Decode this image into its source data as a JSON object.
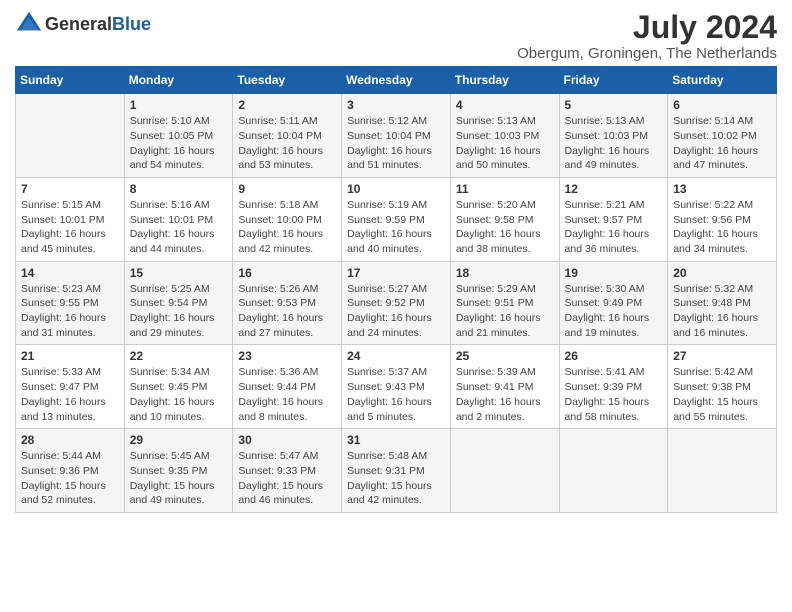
{
  "header": {
    "logo_general": "General",
    "logo_blue": "Blue",
    "month_year": "July 2024",
    "location": "Obergum, Groningen, The Netherlands"
  },
  "days_of_week": [
    "Sunday",
    "Monday",
    "Tuesday",
    "Wednesday",
    "Thursday",
    "Friday",
    "Saturday"
  ],
  "weeks": [
    [
      {
        "day": "",
        "info": ""
      },
      {
        "day": "1",
        "info": "Sunrise: 5:10 AM\nSunset: 10:05 PM\nDaylight: 16 hours\nand 54 minutes."
      },
      {
        "day": "2",
        "info": "Sunrise: 5:11 AM\nSunset: 10:04 PM\nDaylight: 16 hours\nand 53 minutes."
      },
      {
        "day": "3",
        "info": "Sunrise: 5:12 AM\nSunset: 10:04 PM\nDaylight: 16 hours\nand 51 minutes."
      },
      {
        "day": "4",
        "info": "Sunrise: 5:13 AM\nSunset: 10:03 PM\nDaylight: 16 hours\nand 50 minutes."
      },
      {
        "day": "5",
        "info": "Sunrise: 5:13 AM\nSunset: 10:03 PM\nDaylight: 16 hours\nand 49 minutes."
      },
      {
        "day": "6",
        "info": "Sunrise: 5:14 AM\nSunset: 10:02 PM\nDaylight: 16 hours\nand 47 minutes."
      }
    ],
    [
      {
        "day": "7",
        "info": "Sunrise: 5:15 AM\nSunset: 10:01 PM\nDaylight: 16 hours\nand 45 minutes."
      },
      {
        "day": "8",
        "info": "Sunrise: 5:16 AM\nSunset: 10:01 PM\nDaylight: 16 hours\nand 44 minutes."
      },
      {
        "day": "9",
        "info": "Sunrise: 5:18 AM\nSunset: 10:00 PM\nDaylight: 16 hours\nand 42 minutes."
      },
      {
        "day": "10",
        "info": "Sunrise: 5:19 AM\nSunset: 9:59 PM\nDaylight: 16 hours\nand 40 minutes."
      },
      {
        "day": "11",
        "info": "Sunrise: 5:20 AM\nSunset: 9:58 PM\nDaylight: 16 hours\nand 38 minutes."
      },
      {
        "day": "12",
        "info": "Sunrise: 5:21 AM\nSunset: 9:57 PM\nDaylight: 16 hours\nand 36 minutes."
      },
      {
        "day": "13",
        "info": "Sunrise: 5:22 AM\nSunset: 9:56 PM\nDaylight: 16 hours\nand 34 minutes."
      }
    ],
    [
      {
        "day": "14",
        "info": "Sunrise: 5:23 AM\nSunset: 9:55 PM\nDaylight: 16 hours\nand 31 minutes."
      },
      {
        "day": "15",
        "info": "Sunrise: 5:25 AM\nSunset: 9:54 PM\nDaylight: 16 hours\nand 29 minutes."
      },
      {
        "day": "16",
        "info": "Sunrise: 5:26 AM\nSunset: 9:53 PM\nDaylight: 16 hours\nand 27 minutes."
      },
      {
        "day": "17",
        "info": "Sunrise: 5:27 AM\nSunset: 9:52 PM\nDaylight: 16 hours\nand 24 minutes."
      },
      {
        "day": "18",
        "info": "Sunrise: 5:29 AM\nSunset: 9:51 PM\nDaylight: 16 hours\nand 21 minutes."
      },
      {
        "day": "19",
        "info": "Sunrise: 5:30 AM\nSunset: 9:49 PM\nDaylight: 16 hours\nand 19 minutes."
      },
      {
        "day": "20",
        "info": "Sunrise: 5:32 AM\nSunset: 9:48 PM\nDaylight: 16 hours\nand 16 minutes."
      }
    ],
    [
      {
        "day": "21",
        "info": "Sunrise: 5:33 AM\nSunset: 9:47 PM\nDaylight: 16 hours\nand 13 minutes."
      },
      {
        "day": "22",
        "info": "Sunrise: 5:34 AM\nSunset: 9:45 PM\nDaylight: 16 hours\nand 10 minutes."
      },
      {
        "day": "23",
        "info": "Sunrise: 5:36 AM\nSunset: 9:44 PM\nDaylight: 16 hours\nand 8 minutes."
      },
      {
        "day": "24",
        "info": "Sunrise: 5:37 AM\nSunset: 9:43 PM\nDaylight: 16 hours\nand 5 minutes."
      },
      {
        "day": "25",
        "info": "Sunrise: 5:39 AM\nSunset: 9:41 PM\nDaylight: 16 hours\nand 2 minutes."
      },
      {
        "day": "26",
        "info": "Sunrise: 5:41 AM\nSunset: 9:39 PM\nDaylight: 15 hours\nand 58 minutes."
      },
      {
        "day": "27",
        "info": "Sunrise: 5:42 AM\nSunset: 9:38 PM\nDaylight: 15 hours\nand 55 minutes."
      }
    ],
    [
      {
        "day": "28",
        "info": "Sunrise: 5:44 AM\nSunset: 9:36 PM\nDaylight: 15 hours\nand 52 minutes."
      },
      {
        "day": "29",
        "info": "Sunrise: 5:45 AM\nSunset: 9:35 PM\nDaylight: 15 hours\nand 49 minutes."
      },
      {
        "day": "30",
        "info": "Sunrise: 5:47 AM\nSunset: 9:33 PM\nDaylight: 15 hours\nand 46 minutes."
      },
      {
        "day": "31",
        "info": "Sunrise: 5:48 AM\nSunset: 9:31 PM\nDaylight: 15 hours\nand 42 minutes."
      },
      {
        "day": "",
        "info": ""
      },
      {
        "day": "",
        "info": ""
      },
      {
        "day": "",
        "info": ""
      }
    ]
  ]
}
